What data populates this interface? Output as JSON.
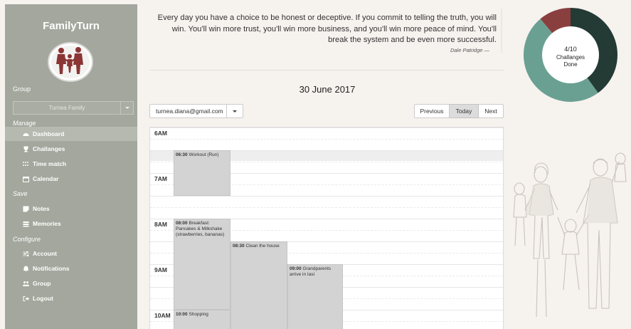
{
  "app": {
    "title": "FamilyTurn"
  },
  "sidebar": {
    "group_label": "Group",
    "group_value": "Turnea Family",
    "sections": {
      "manage": "Manage",
      "save": "Save",
      "configure": "Configure"
    },
    "items": [
      {
        "label": "Dashboard",
        "icon": "dashboard-icon"
      },
      {
        "label": "Challanges",
        "icon": "trophy-icon"
      },
      {
        "label": "Time match",
        "icon": "grid-icon"
      },
      {
        "label": "Calendar",
        "icon": "calendar-icon"
      },
      {
        "label": "Notes",
        "icon": "note-icon"
      },
      {
        "label": "Memories",
        "icon": "list-icon"
      },
      {
        "label": "Account",
        "icon": "sliders-icon"
      },
      {
        "label": "Notifications",
        "icon": "bell-icon"
      },
      {
        "label": "Group",
        "icon": "users-icon"
      },
      {
        "label": "Logout",
        "icon": "logout-icon"
      }
    ]
  },
  "quote": {
    "text": "Every day you have a choice to be honest or deceptive. If you commit to telling the truth, you will win. You'll win more trust, you'll win more business, and you'll win more peace of mind. You'll break the system and be even more successful.",
    "author": "Dale Patridge —"
  },
  "challenges": {
    "done": 4,
    "total": 10,
    "count_label": "4/10",
    "caption_line1": "Challanges",
    "caption_line2": "Done",
    "colors": {
      "done": "#6aa092",
      "remaining": "#233a35",
      "accent": "#8a3f3f"
    }
  },
  "calendar": {
    "date_title": "30 June 2017",
    "user_email": "turnea.diana@gmail.com",
    "nav": {
      "previous": "Previous",
      "today": "Today",
      "next": "Next"
    },
    "hours": [
      "6AM",
      "7AM",
      "8AM",
      "9AM",
      "10AM"
    ],
    "events": [
      {
        "time": "06:30",
        "title": "Workout (Run)"
      },
      {
        "time": "08:00",
        "title": "Breakfast: Pancakes & Milkshake (strawberries, bananas)"
      },
      {
        "time": "08:30",
        "title": "Clean the house"
      },
      {
        "time": "09:00",
        "title": "Grandparents arrive in Iasi"
      },
      {
        "time": "10:00",
        "title": "Shopping"
      }
    ]
  }
}
